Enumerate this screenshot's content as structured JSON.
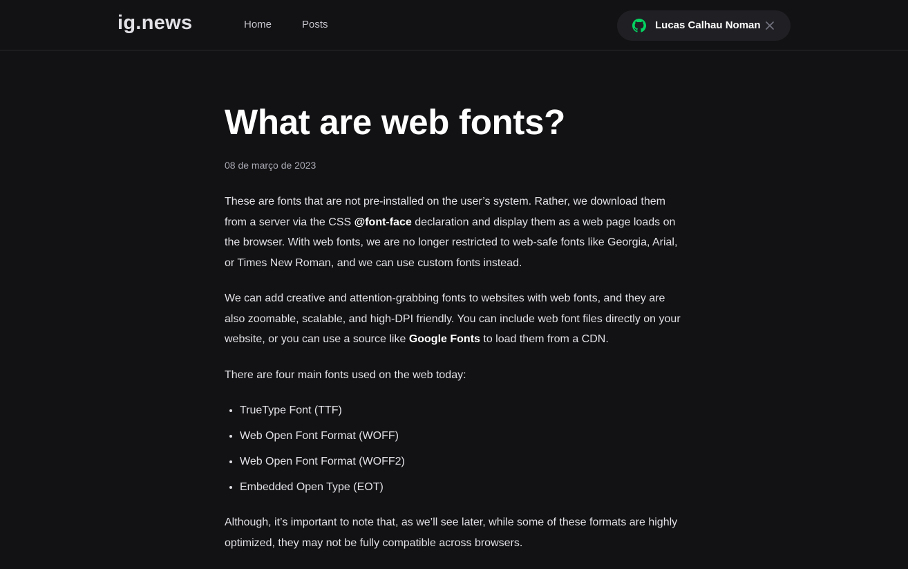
{
  "header": {
    "logo": "ig.news",
    "nav": [
      {
        "label": "Home"
      },
      {
        "label": "Posts"
      }
    ],
    "user": {
      "name": "Lucas Calhau Noman",
      "icon": "github-icon",
      "icon_color": "#04d361",
      "close_icon": "close-icon"
    }
  },
  "post": {
    "title": "What are web fonts?",
    "date": "08 de março de 2023",
    "p1": {
      "a": "These are fonts that are not pre-installed on the user’s system. Rather, we download them from a server via the CSS ",
      "strong": "@font-face",
      "b": " declaration and display them as a web page loads on the browser. With web fonts, we are no longer restricted to web-safe fonts like Georgia, Arial, or Times New Roman, and we can use custom fonts instead."
    },
    "p2": {
      "a": "We can add creative and attention-grabbing fonts to websites with web fonts, and they are also zoomable, scalable, and high-DPI friendly. You can include web font files directly on your website, or you can use a source like ",
      "strong": "Google Fonts",
      "b": " to load them from a CDN."
    },
    "p3": "There are four main fonts used on the web today:",
    "list": [
      "TrueType Font (TTF)",
      "Web Open Font Format (WOFF)",
      "Web Open Font Format (WOFF2)",
      "Embedded Open Type (EOT)"
    ],
    "p4": "Although, it’s important to note that, as we’ll see later, while some of these formats are highly optimized, they may not be fully compatible across browsers."
  }
}
